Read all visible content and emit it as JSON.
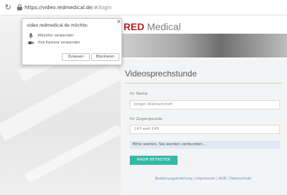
{
  "browser": {
    "url_host": "https://video.redmedical.de",
    "url_path": "/#/login"
  },
  "brand": {
    "name_bold": "RED",
    "name_rest": " Medical",
    "color": "#b11f24"
  },
  "form": {
    "title": "Videosprechstunde",
    "name_label": "Ihr Name",
    "name_value": "Jürgen Kleinschmidt",
    "code_label": "Ihr Zugangscode",
    "code_value": "147-aa4-149",
    "status_text": "Bitte warten, Sie werden verbunden...",
    "join_button": "RAUM BETRETEN",
    "join_color": "#35b9a7"
  },
  "footer": {
    "link1": "Bedienungsanleitung",
    "link2": "Impressum",
    "link3": "AGB",
    "link4": "Datenschutz",
    "separator": " | "
  },
  "permission_popup": {
    "title": "video.redmedical.de möchte:",
    "mic_text": "Mikrofon verwenden",
    "mic_icon": "microphone-icon",
    "cam_text": "Ihre Kamera verwenden",
    "cam_icon": "camera-icon",
    "allow_button": "Zulassen",
    "block_button": "Blockieren",
    "close_glyph": "×"
  }
}
